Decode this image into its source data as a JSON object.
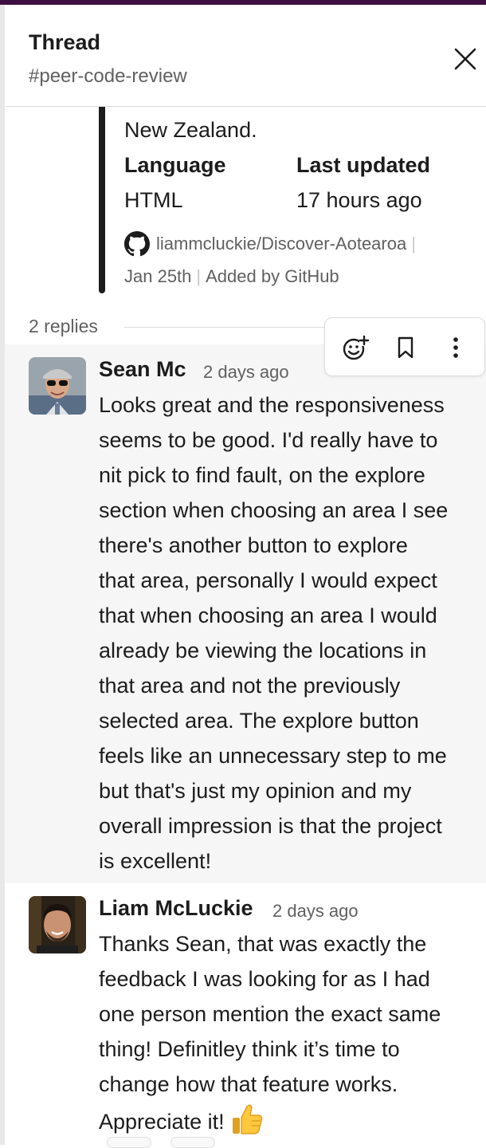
{
  "header": {
    "title": "Thread",
    "channel": "#peer-code-review"
  },
  "unfurl": {
    "description_tail": "New Zealand.",
    "fields": [
      {
        "label": "Language",
        "value": "HTML"
      },
      {
        "label": "Last updated",
        "value": "17 hours ago"
      }
    ],
    "repo": "liammcluckie/Discover-Aotearoa",
    "date": "Jan 25th",
    "added_by": "Added by GitHub"
  },
  "thread": {
    "replies_count": "2 replies"
  },
  "messages": [
    {
      "author": "Sean Mc",
      "time": "2 days ago",
      "lines": [
        "Looks great and the responsiveness",
        "seems to be good. I'd really have to",
        "nit pick to find fault, on the explore",
        "section when choosing an area I see",
        "there's another button to explore",
        "that area, personally I would expect",
        "that when choosing an area I would",
        "already be viewing the locations in",
        "that area and not the previously",
        "selected area. The explore button",
        "feels like an unnecessary step to me",
        "but that's just my opinion and my",
        "overall impression is that the project",
        "is excellent!"
      ]
    },
    {
      "author": "Liam McLuckie",
      "time": "2 days ago",
      "lines": [
        "Thanks Sean, that was exactly the",
        "feedback I was looking for as I had",
        "one person mention the exact same",
        "thing! Definitley think it’s time to",
        "change how that feature works.",
        "Appreciate it!"
      ],
      "emoji": "thumbs-up"
    }
  ],
  "hover_toolbar": {
    "icons": [
      "add-reaction-icon",
      "bookmark-icon",
      "more-actions-icon"
    ]
  },
  "colors": {
    "brand_bar": "#3f0e40",
    "hover_bg": "#f6f6f6",
    "muted_text": "#616061"
  }
}
